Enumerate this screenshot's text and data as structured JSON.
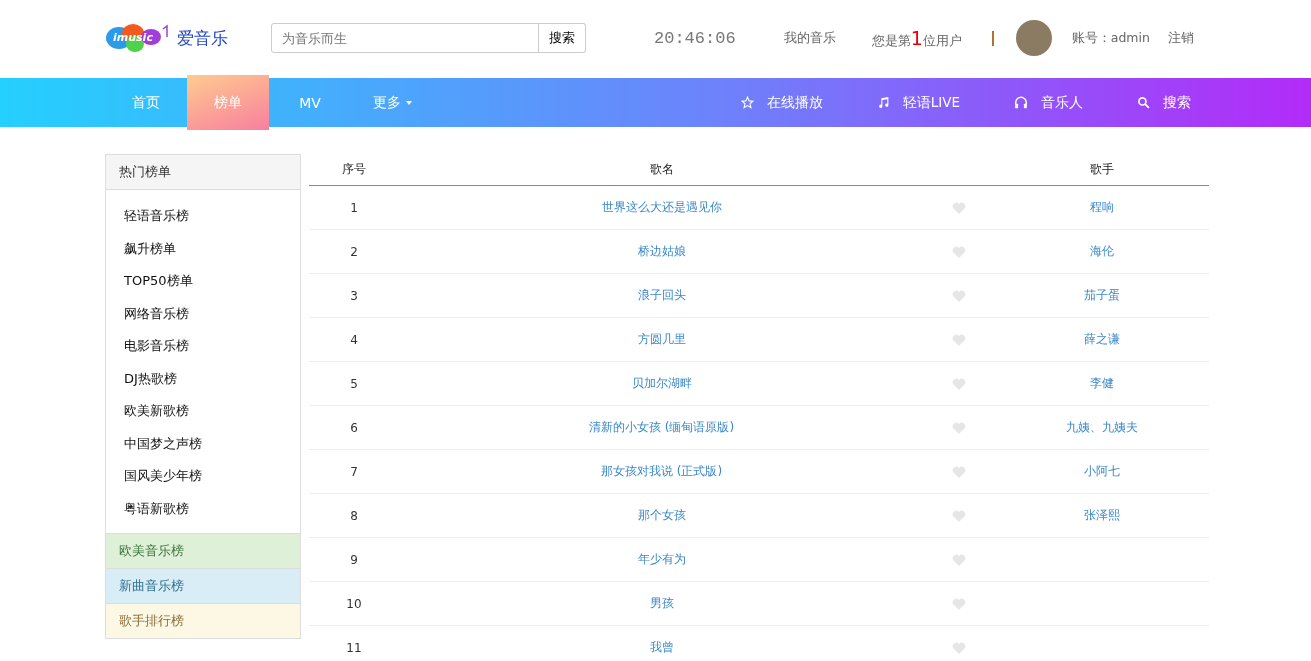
{
  "header": {
    "logo_text": "imusic",
    "brand": "爱音乐",
    "search": {
      "placeholder": "为音乐而生",
      "button": "搜索"
    },
    "clock": "20:46:06",
    "my_music": "我的音乐",
    "user_count": {
      "before": "您是第",
      "number": "1",
      "after": "位用户"
    },
    "account": "账号：admin",
    "logout": "注销"
  },
  "nav": {
    "left": [
      {
        "label": "首页",
        "selected": false,
        "dropdown": false
      },
      {
        "label": "榜单",
        "selected": true,
        "dropdown": false
      },
      {
        "label": "MV",
        "selected": false,
        "dropdown": false
      },
      {
        "label": "更多",
        "selected": false,
        "dropdown": true
      }
    ],
    "right": [
      {
        "label": "在线播放",
        "kind": "star"
      },
      {
        "label": "轻语LIVE",
        "kind": "music"
      },
      {
        "label": "音乐人",
        "kind": "headphones"
      },
      {
        "label": "搜索",
        "kind": "search"
      }
    ]
  },
  "sidebar": {
    "title": "热门榜单",
    "items": [
      "轻语音乐榜",
      "飙升榜单",
      "TOP50榜单",
      "网络音乐榜",
      "电影音乐榜",
      "DJ热歌榜",
      "欧美新歌榜",
      "中国梦之声榜",
      "国风美少年榜",
      "粤语新歌榜"
    ],
    "groups": [
      {
        "label": "欧美音乐榜",
        "color": "#dff0d8"
      },
      {
        "label": "新曲音乐榜",
        "color": "#d9edf7"
      },
      {
        "label": "歌手排行榜",
        "color": "#fcf8e3"
      }
    ]
  },
  "table": {
    "columns": [
      "序号",
      "歌名",
      "歌手"
    ],
    "rows": [
      {
        "no": "1",
        "song": "世界这么大还是遇见你",
        "singer": "程响"
      },
      {
        "no": "2",
        "song": "桥边姑娘",
        "singer": "海伦"
      },
      {
        "no": "3",
        "song": "浪子回头",
        "singer": "茄子蛋"
      },
      {
        "no": "4",
        "song": "方圆几里",
        "singer": "薛之谦"
      },
      {
        "no": "5",
        "song": "贝加尔湖畔",
        "singer": "李健"
      },
      {
        "no": "6",
        "song": "清新的小女孩 (缅甸语原版)",
        "singer": "九姨、九姨夫"
      },
      {
        "no": "7",
        "song": "那女孩对我说 (正式版)",
        "singer": "小阿七"
      },
      {
        "no": "8",
        "song": "那个女孩",
        "singer": "张泽熙"
      },
      {
        "no": "9",
        "song": "年少有为"
      },
      {
        "no": "10",
        "song": "男孩"
      },
      {
        "no": "11",
        "song": "我曾"
      }
    ]
  }
}
